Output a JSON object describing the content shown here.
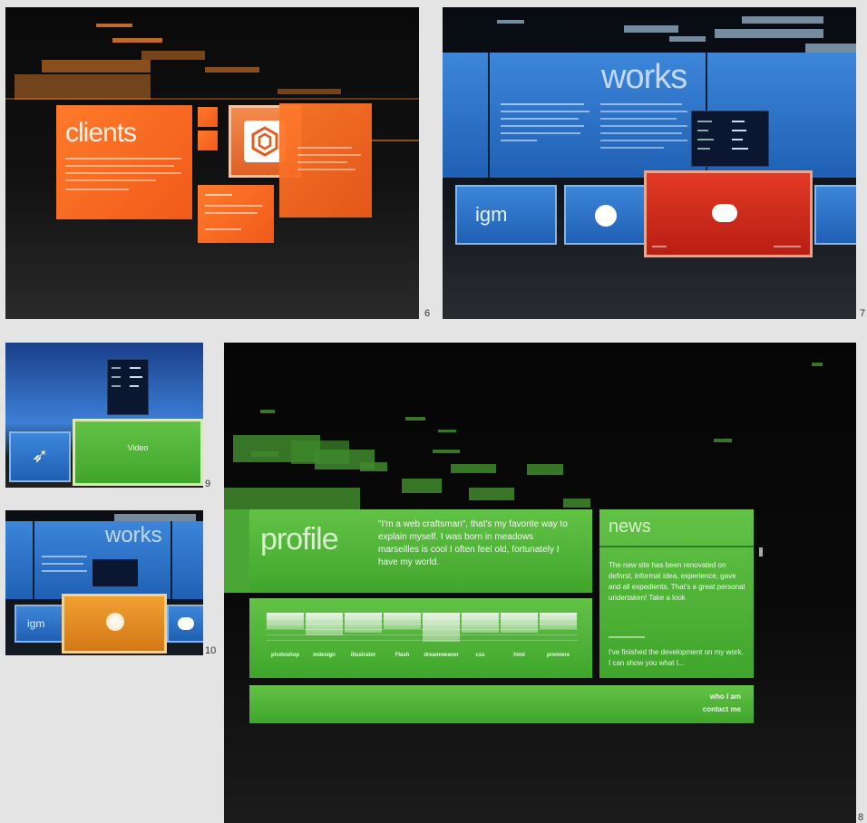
{
  "figure_numbers": {
    "p6": "6",
    "p7": "7",
    "p8": "8",
    "p9": "9",
    "p10": "10"
  },
  "clients_panel": {
    "title": "clients"
  },
  "works_panel": {
    "title": "works",
    "tiles": {
      "first": "igm"
    }
  },
  "panel9": {
    "tile_label": "Video"
  },
  "panel10": {
    "title": "works",
    "tile_label": "igm"
  },
  "profile_panel": {
    "title": "profile",
    "intro": "\"I'm a web craftsman\", that's my favorite way to explain myself. I was born in meadows marseilles is cool I often feel old, fortunately I have my world.",
    "skills": [
      "photoshop",
      "indesign",
      "illustrator",
      "Flash",
      "dreamweaver",
      "css",
      "html",
      "premiere"
    ],
    "skill_levels": [
      0.5,
      0.7,
      0.6,
      0.5,
      0.9,
      0.6,
      0.6,
      0.5
    ],
    "news_title": "news",
    "news_text_1": "The new site has been renovated on defnrst, informat idea, experience, gave and all expedients. That's a great personal undertaken! Take a look",
    "news_text_2": "I've finished the development on my work. I can show you what I...",
    "footer_links": [
      "who I am",
      "contact me"
    ]
  },
  "colors": {
    "orange": "#f06020",
    "blue": "#2f74c8",
    "green": "#52b43a",
    "red": "#d02a1c"
  }
}
